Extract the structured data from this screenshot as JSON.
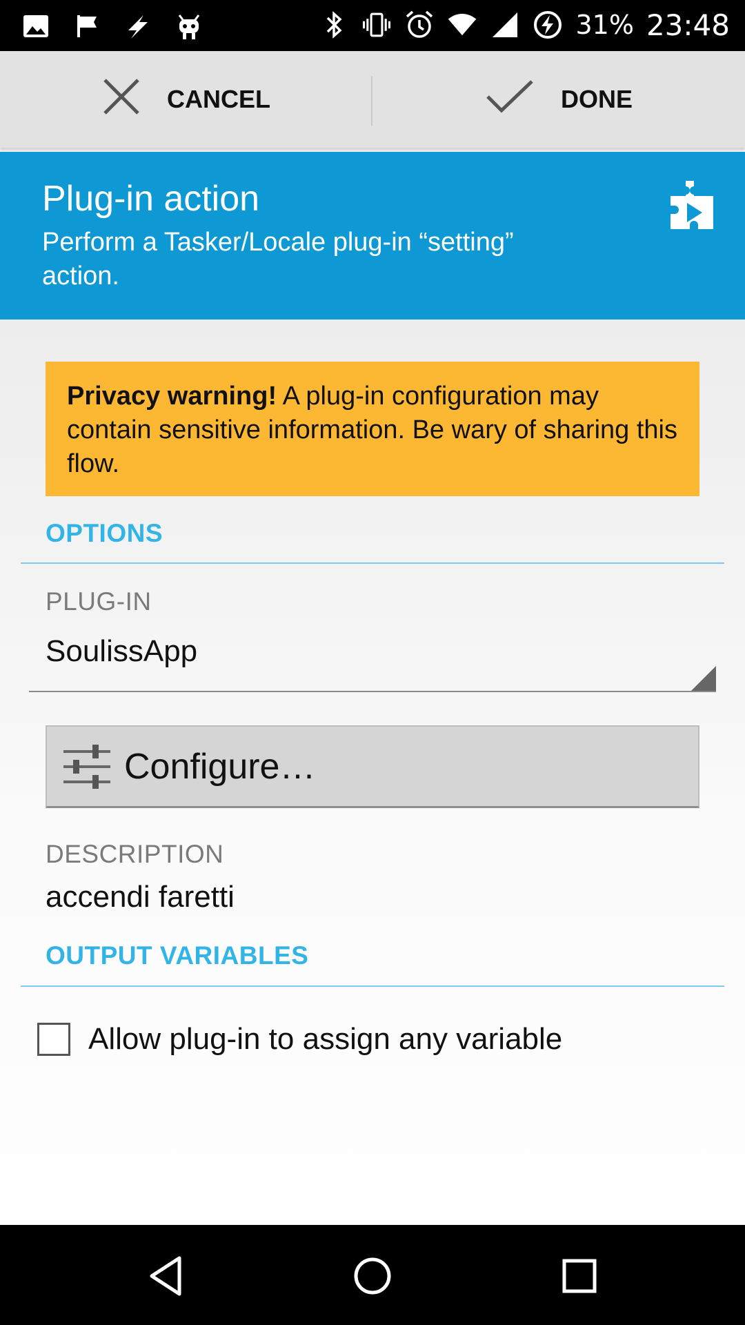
{
  "status_bar": {
    "battery": "31%",
    "time": "23:48",
    "left_icons": [
      "image-icon",
      "flag-icon",
      "bolt-icon",
      "android-icon"
    ],
    "right_icons": [
      "bluetooth-icon",
      "vibrate-icon",
      "alarm-icon",
      "wifi-icon",
      "signal-icon",
      "battery-charging-icon"
    ]
  },
  "action_bar": {
    "cancel_label": "CANCEL",
    "done_label": "DONE"
  },
  "header": {
    "title": "Plug-in action",
    "subtitle": "Perform a Tasker/Locale plug-in “setting” action."
  },
  "warning": {
    "bold": "Privacy warning!",
    "text": " A plug-in configuration may contain sensitive information. Be wary of sharing this flow.",
    "color": "#fdb833"
  },
  "options": {
    "section_title": "OPTIONS",
    "plugin_label": "PLUG-IN",
    "plugin_value": "SoulissApp",
    "configure_label": "Configure…",
    "description_label": "DESCRIPTION",
    "description_value": "accendi faretti"
  },
  "output": {
    "section_title": "OUTPUT VARIABLES",
    "checkbox_label": "Allow plug-in to assign any variable",
    "checkbox_checked": false
  },
  "colors": {
    "header": "#0e99d5",
    "section_accent": "#33b4e6"
  },
  "nav_bar": {
    "icons": [
      "back-icon",
      "home-icon",
      "recents-icon"
    ]
  }
}
